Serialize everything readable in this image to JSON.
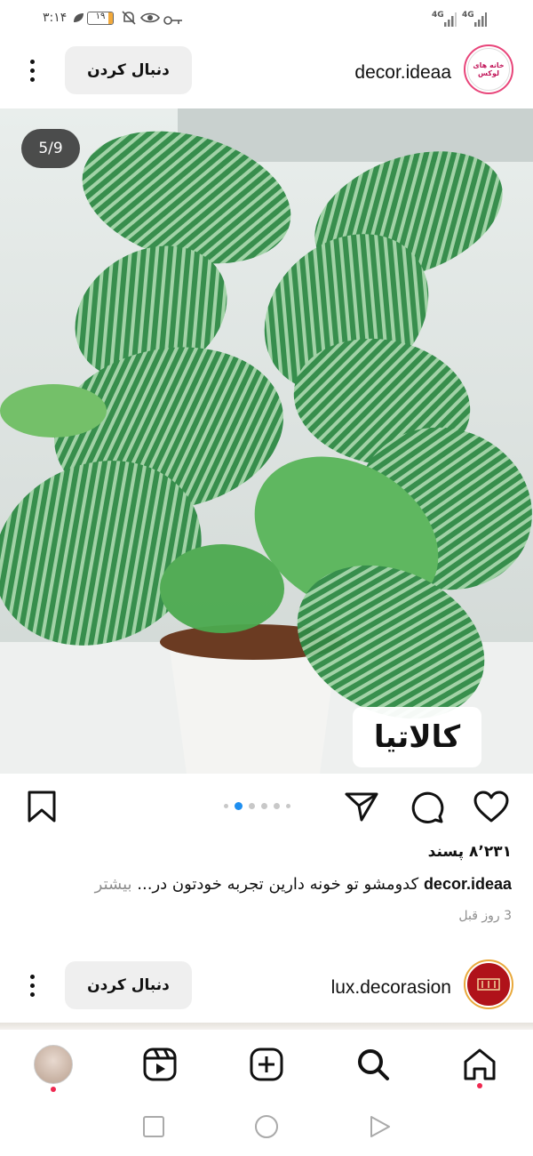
{
  "status_bar": {
    "time": "۳:۱۴",
    "battery_level": "۱۹",
    "battery_fraction": 0.19,
    "network_1": "4G",
    "network_2": "4G",
    "icons": [
      "leaf-icon",
      "battery-icon",
      "muted-bell-icon",
      "eye-icon",
      "key-icon",
      "signal-icon"
    ]
  },
  "post": {
    "avatar_text": "خانه های لوکس",
    "username": "decor.ideaa",
    "follow_label": "دنبال کردن",
    "image_counter": "5/9",
    "image_label": "کالاتیا",
    "likes": "۸٬۲۳۱ پسند",
    "caption_user": "decor.ideaa",
    "caption_text": "کدومشو تو خونه دارین تجربه خودتون در...",
    "caption_more": "بیشتر",
    "timestamp": "3 روز قبل",
    "carousel_total": 6,
    "carousel_active": 1
  },
  "next_post": {
    "username": "lux.decorasion",
    "follow_label": "دنبال کردن"
  },
  "bottom_nav": {
    "items": [
      "profile",
      "reels-icon",
      "new-post-icon",
      "search-icon",
      "home-icon"
    ]
  },
  "colors": {
    "accent_blue": "#1f8ff0",
    "notification_red": "#ef2850",
    "follow_button_bg": "#efefef"
  }
}
